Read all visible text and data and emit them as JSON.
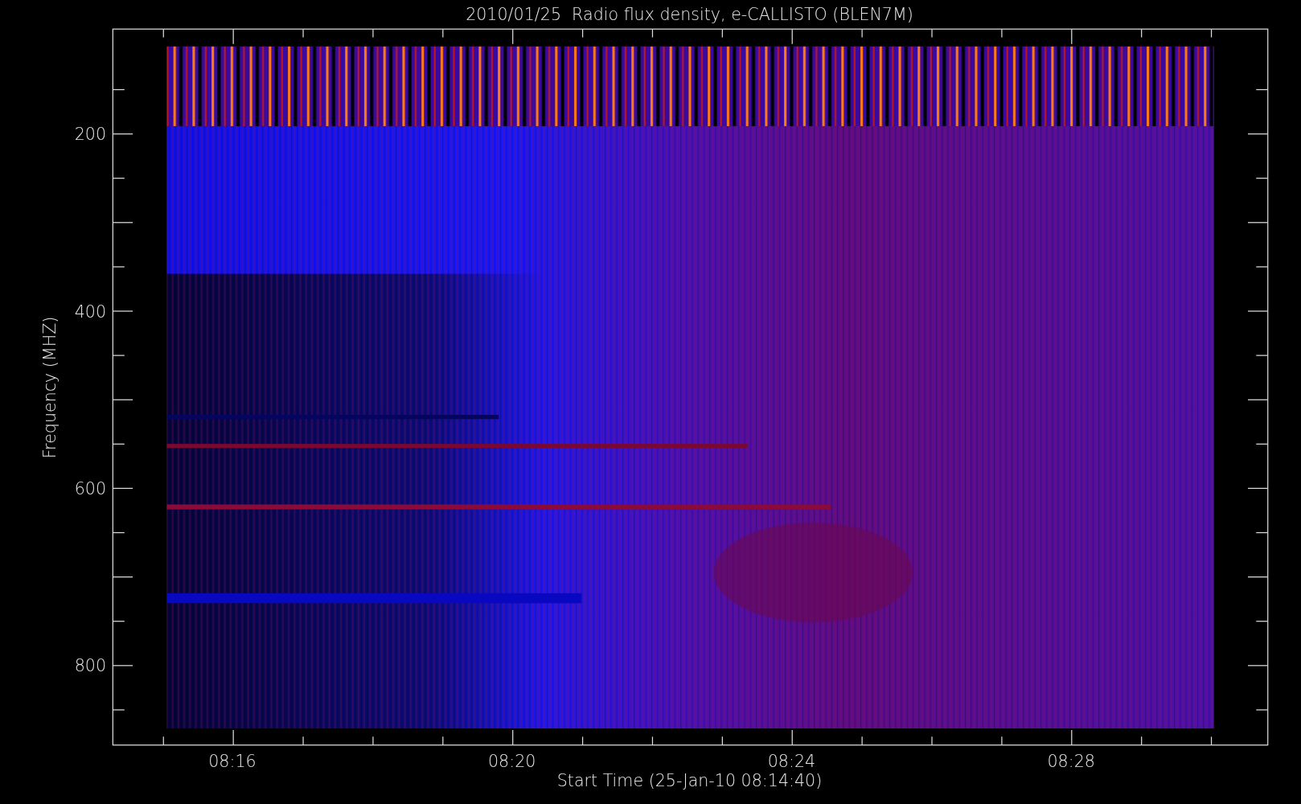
{
  "title": "2010/01/25  Radio flux density, e-CALLISTO (BLEN7M)",
  "y_axis": {
    "label": "Frequency (MHZ)",
    "ticks": [
      "200",
      "400",
      "600",
      "800"
    ]
  },
  "x_axis": {
    "label": "Start Time (25-Jan-10 08:14:40)",
    "ticks": [
      "08:16",
      "08:20",
      "08:24",
      "08:28"
    ]
  }
}
